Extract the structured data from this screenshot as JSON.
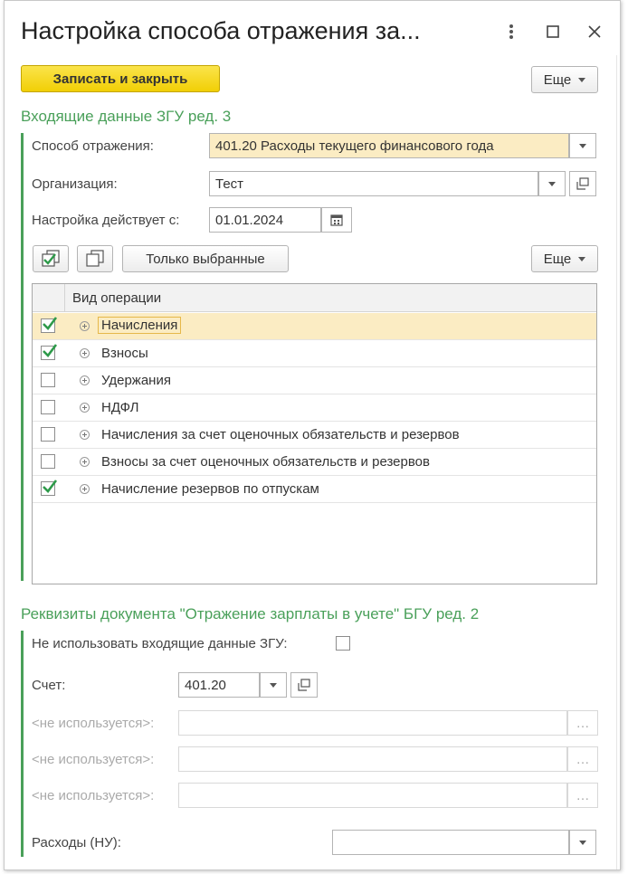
{
  "window": {
    "title": "Настройка способа отражения за..."
  },
  "toolbar": {
    "save_close_label": "Записать и закрыть",
    "more_label": "Еще"
  },
  "section1": {
    "title": "Входящие данные ЗГУ ред. 3",
    "method_label": "Способ отражения:",
    "method_value": "401.20 Расходы текущего финансового года",
    "org_label": "Организация:",
    "org_value": "Тест",
    "date_label": "Настройка действует с:",
    "date_value": "01.01.2024",
    "only_selected_label": "Только выбранные",
    "more_label": "Еще"
  },
  "table": {
    "column_header": "Вид операции",
    "rows": [
      {
        "label": "Начисления",
        "checked": true
      },
      {
        "label": "Взносы",
        "checked": true
      },
      {
        "label": "Удержания",
        "checked": false
      },
      {
        "label": "НДФЛ",
        "checked": false
      },
      {
        "label": "Начисления за счет оценочных обязательств и резервов",
        "checked": false
      },
      {
        "label": "Взносы за счет оценочных обязательств и резервов",
        "checked": false
      },
      {
        "label": "Начисление резервов по отпускам",
        "checked": true
      }
    ]
  },
  "section2": {
    "title": "Реквизиты документа \"Отражение зарплаты в учете\" БГУ ред. 2",
    "no_incoming_label": "Не использовать входящие данные ЗГУ:",
    "account_label": "Счет:",
    "account_value": "401.20",
    "unused1_label": "<не используется>:",
    "unused2_label": "<не используется>:",
    "unused3_label": "<не используется>:",
    "expenses_label": "Расходы (НУ):",
    "expenses_value": ""
  },
  "colors": {
    "accent_green": "#4aa05a",
    "primary_yellow": "#f1cf05",
    "selected_row": "#fbecc3",
    "check_green": "#2e9a4a"
  }
}
